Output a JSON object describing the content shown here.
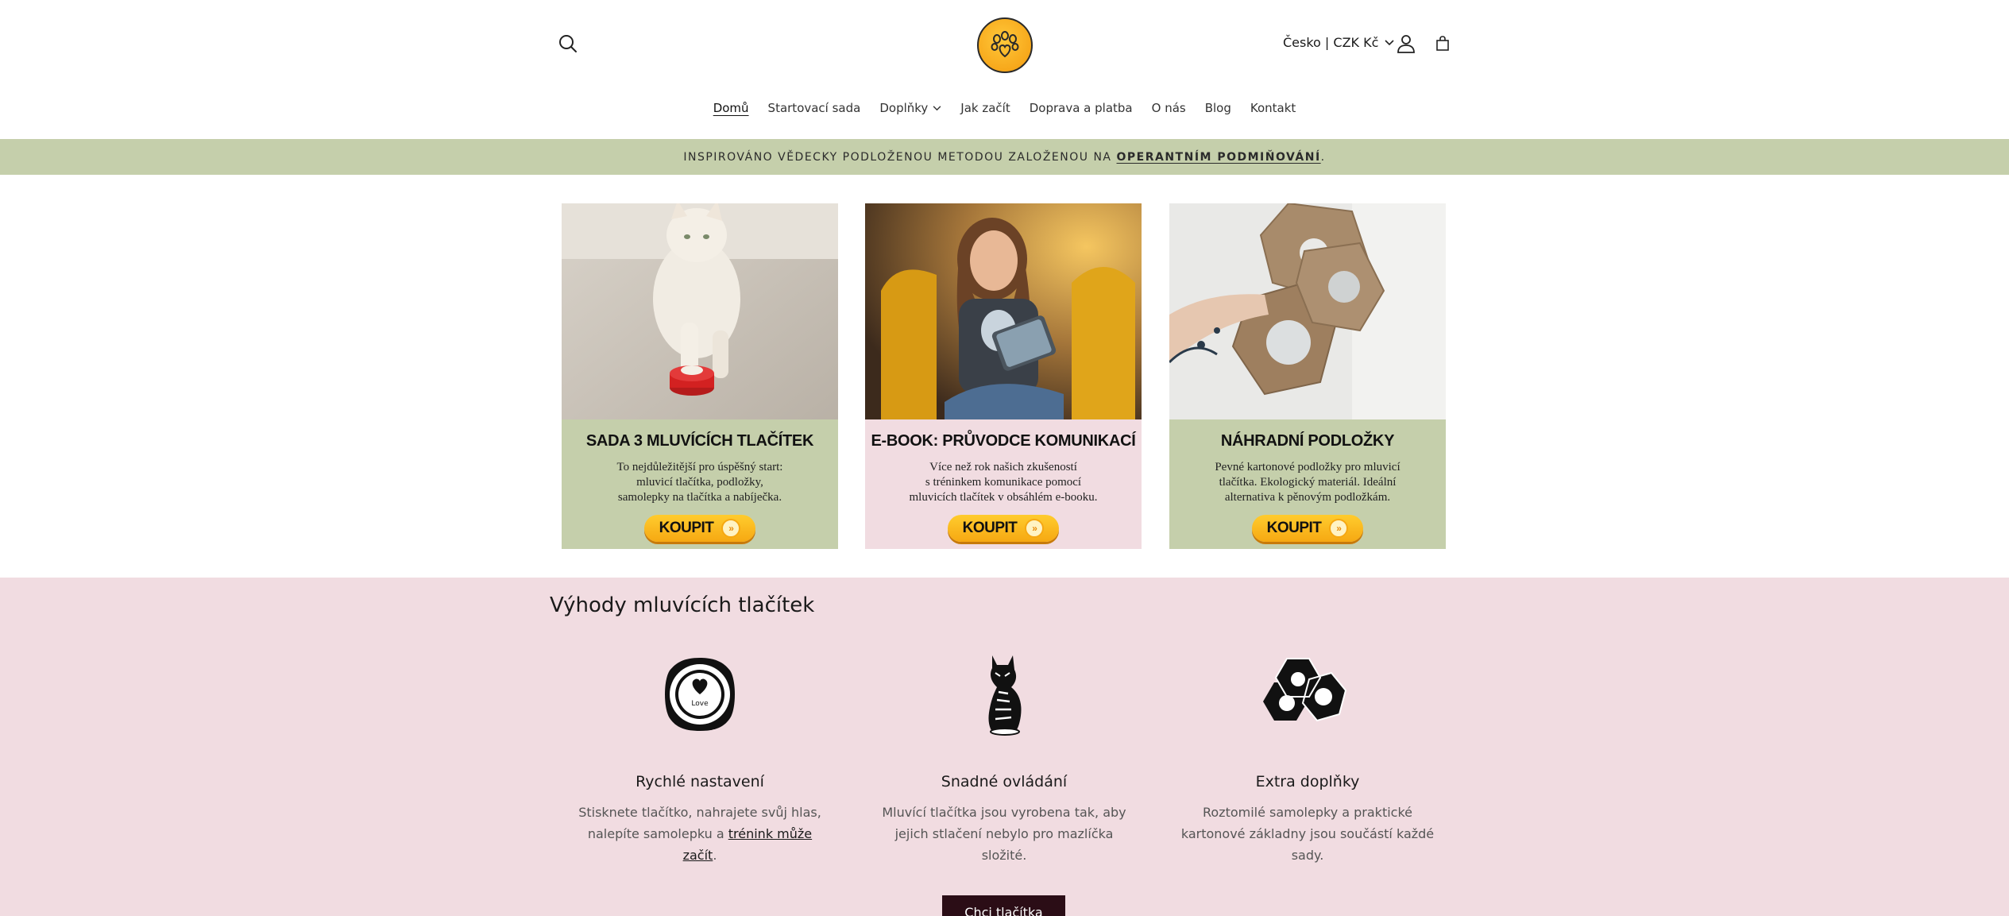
{
  "header": {
    "locale": "Česko | CZK Kč",
    "search_label": "Hledat",
    "account_label": "Přihlásit se",
    "cart_label": "Košík"
  },
  "nav": {
    "items": [
      {
        "label": "Domů",
        "active": true
      },
      {
        "label": "Startovací sada"
      },
      {
        "label": "Doplňky",
        "has_dropdown": true
      },
      {
        "label": "Jak začít"
      },
      {
        "label": "Doprava a platba"
      },
      {
        "label": "O nás"
      },
      {
        "label": "Blog"
      },
      {
        "label": "Kontakt"
      }
    ]
  },
  "announcement": {
    "text": "INSPIROVÁNO VĚDECKY PODLOŽENOU METODOU ZALOŽENOU NA",
    "link": "OPERANTNÍM PODMIŇOVÁNÍ",
    "suffix": "."
  },
  "products": [
    {
      "title": "SADA 3 MLUVÍCÍCH TLAČÍTEK",
      "lines": [
        "To nejdůležitější pro úspěšný start:",
        "mluvicí tlačítka, podložky,",
        "samolepky na tlačítka a nabíječka."
      ],
      "button": "KOUPIT",
      "panel_color": "#c5cfab"
    },
    {
      "title": "E-BOOK: PRŮVODCE KOMUNIKACÍ",
      "lines": [
        "Více než rok našich zkušeností",
        "s tréninkem komunikace pomocí",
        "mluvicích tlačítek v obsáhlém e-booku."
      ],
      "button": "KOUPIT",
      "panel_color": "#f1dce1"
    },
    {
      "title": "NÁHRADNÍ PODLOŽKY",
      "lines": [
        "Pevné kartonové podložky pro mluvicí",
        "tlačítka. Ekologický materiál. Ideální",
        "alternativa k pěnovým podložkám."
      ],
      "button": "KOUPIT",
      "panel_color": "#c5cfab"
    }
  ],
  "benefits": {
    "heading": "Výhody mluvících tlačítek",
    "items": [
      {
        "title": "Rychlé nastavení",
        "text_before": "Stisknete tlačítko, nahrajete svůj hlas, nalepíte samolepku a ",
        "link": "trénink může začít",
        "text_after": ".",
        "icon": "love-button-icon",
        "icon_text": "Love"
      },
      {
        "title": "Snadné ovládání",
        "text_before": "Mluvící tlačítka jsou vyrobena tak, aby jejich stlačení nebylo pro mazlíčka složité.",
        "icon": "cat-icon"
      },
      {
        "title": "Extra doplňky",
        "text_before": "Roztomilé samolepky a praktické kartonové základny jsou součástí každé sady.",
        "icon": "hexagon-mats-icon"
      }
    ],
    "cta": "Chci tlačítka"
  },
  "colors": {
    "sage": "#c5cfab",
    "pink": "#f1dce1",
    "accent_yellow": "#f6a812",
    "cta_dark": "#2b0d16"
  }
}
